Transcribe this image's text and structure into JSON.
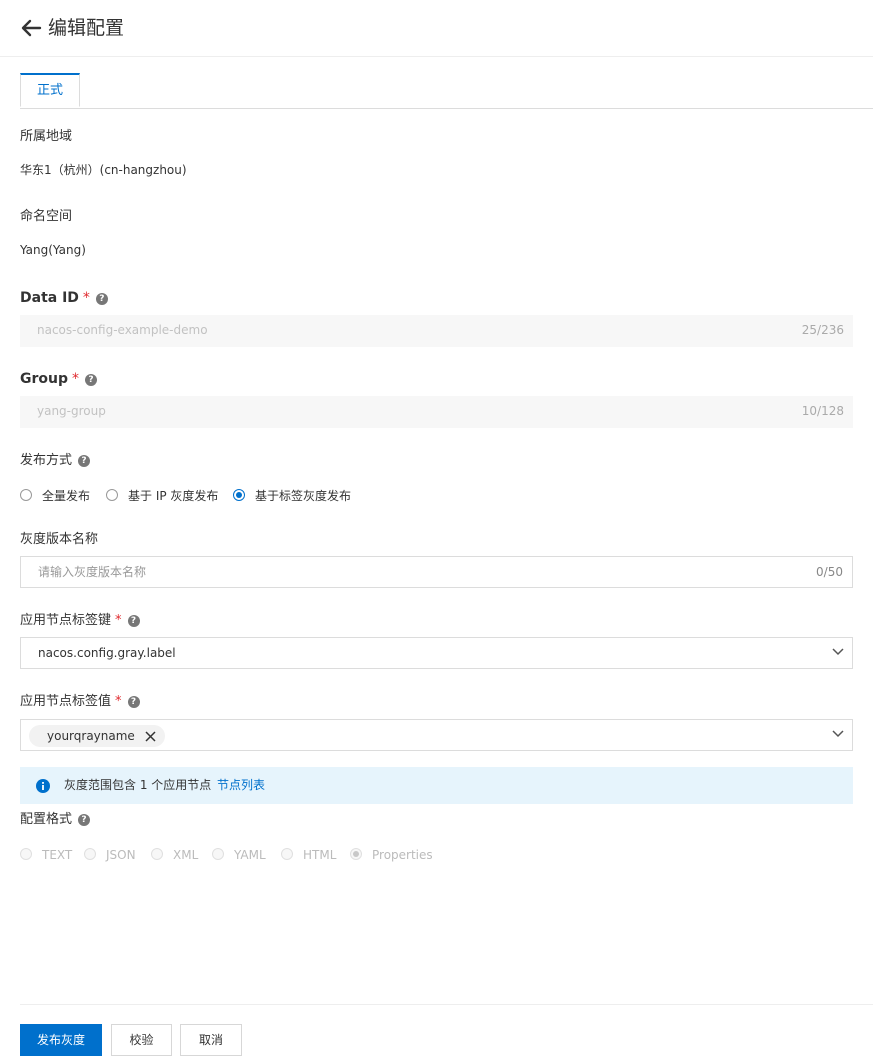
{
  "header": {
    "title": "编辑配置"
  },
  "tabs": [
    {
      "label": "正式"
    }
  ],
  "region": {
    "label": "所属地域",
    "value": "华东1（杭州）(cn-hangzhou)"
  },
  "namespace": {
    "label": "命名空间",
    "value": "Yang(Yang)"
  },
  "data_id": {
    "label": "Data ID",
    "value": "nacos-config-example-demo",
    "counter": "25/236"
  },
  "group": {
    "label": "Group",
    "value": "yang-group",
    "counter": "10/128"
  },
  "publish_mode": {
    "label": "发布方式",
    "options": [
      "全量发布",
      "基于 IP 灰度发布",
      "基于标签灰度发布"
    ],
    "selected": "基于标签灰度发布"
  },
  "gray_version_name": {
    "label": "灰度版本名称",
    "placeholder": "请输入灰度版本名称",
    "counter": "0/50"
  },
  "tag_key": {
    "label": "应用节点标签键",
    "value": "nacos.config.gray.label"
  },
  "tag_value": {
    "label": "应用节点标签值",
    "tags": [
      "yourqrayname"
    ]
  },
  "notice": {
    "text": "灰度范围包含 1 个应用节点",
    "link": "节点列表"
  },
  "config_format": {
    "label": "配置格式",
    "options": [
      "TEXT",
      "JSON",
      "XML",
      "YAML",
      "HTML",
      "Properties"
    ],
    "selected": "Properties"
  },
  "footer": {
    "publish_gray": "发布灰度",
    "validate": "校验",
    "cancel": "取消"
  },
  "colors": {
    "primary": "#0070cc",
    "required": "#e0292e",
    "notice_bg": "#e6f4fc"
  }
}
